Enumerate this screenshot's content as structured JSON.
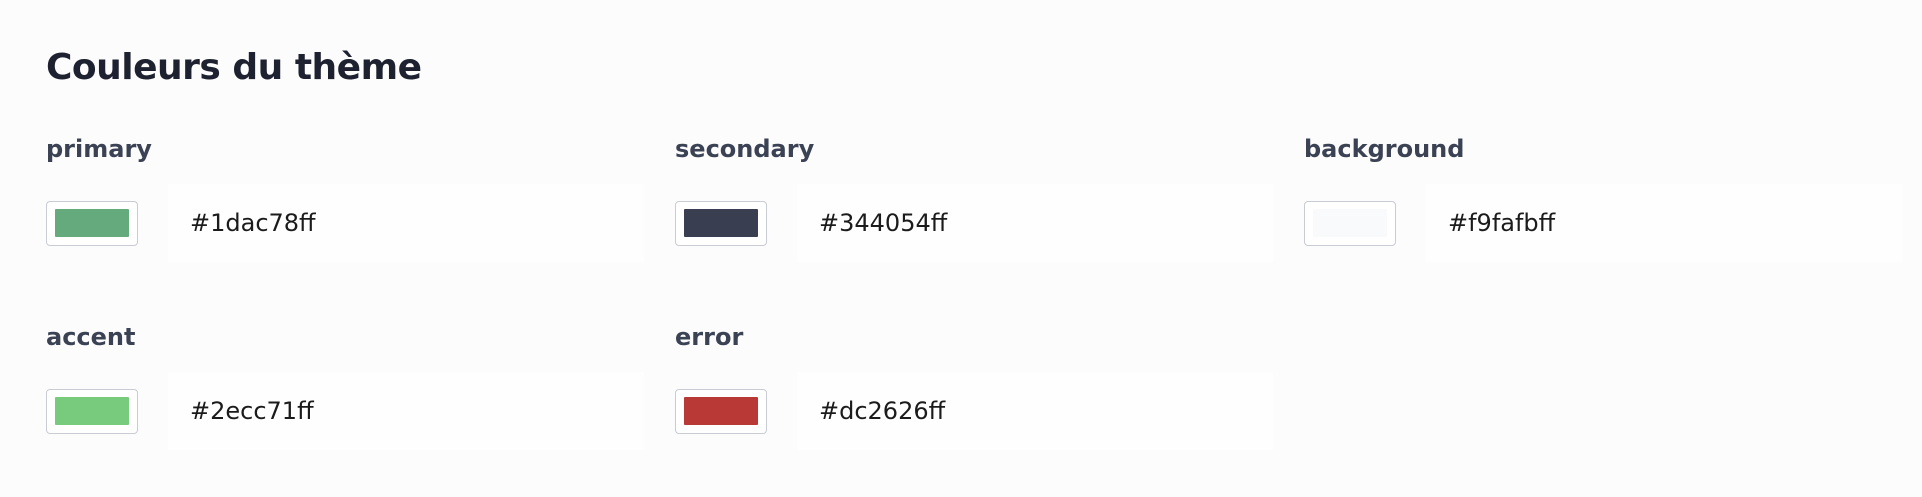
{
  "panel": {
    "title": "Couleurs du thème"
  },
  "colors": [
    {
      "label": "primary",
      "value": "#1dac78ff",
      "swatch": "#64aa7c"
    },
    {
      "label": "secondary",
      "value": "#344054ff",
      "swatch": "#393e51"
    },
    {
      "label": "background",
      "value": "#f9fafbff",
      "swatch": "#f9fafb"
    },
    {
      "label": "accent",
      "value": "#2ecc71ff",
      "swatch": "#78ca7c"
    },
    {
      "label": "error",
      "value": "#dc2626ff",
      "swatch": "#b83935"
    }
  ]
}
